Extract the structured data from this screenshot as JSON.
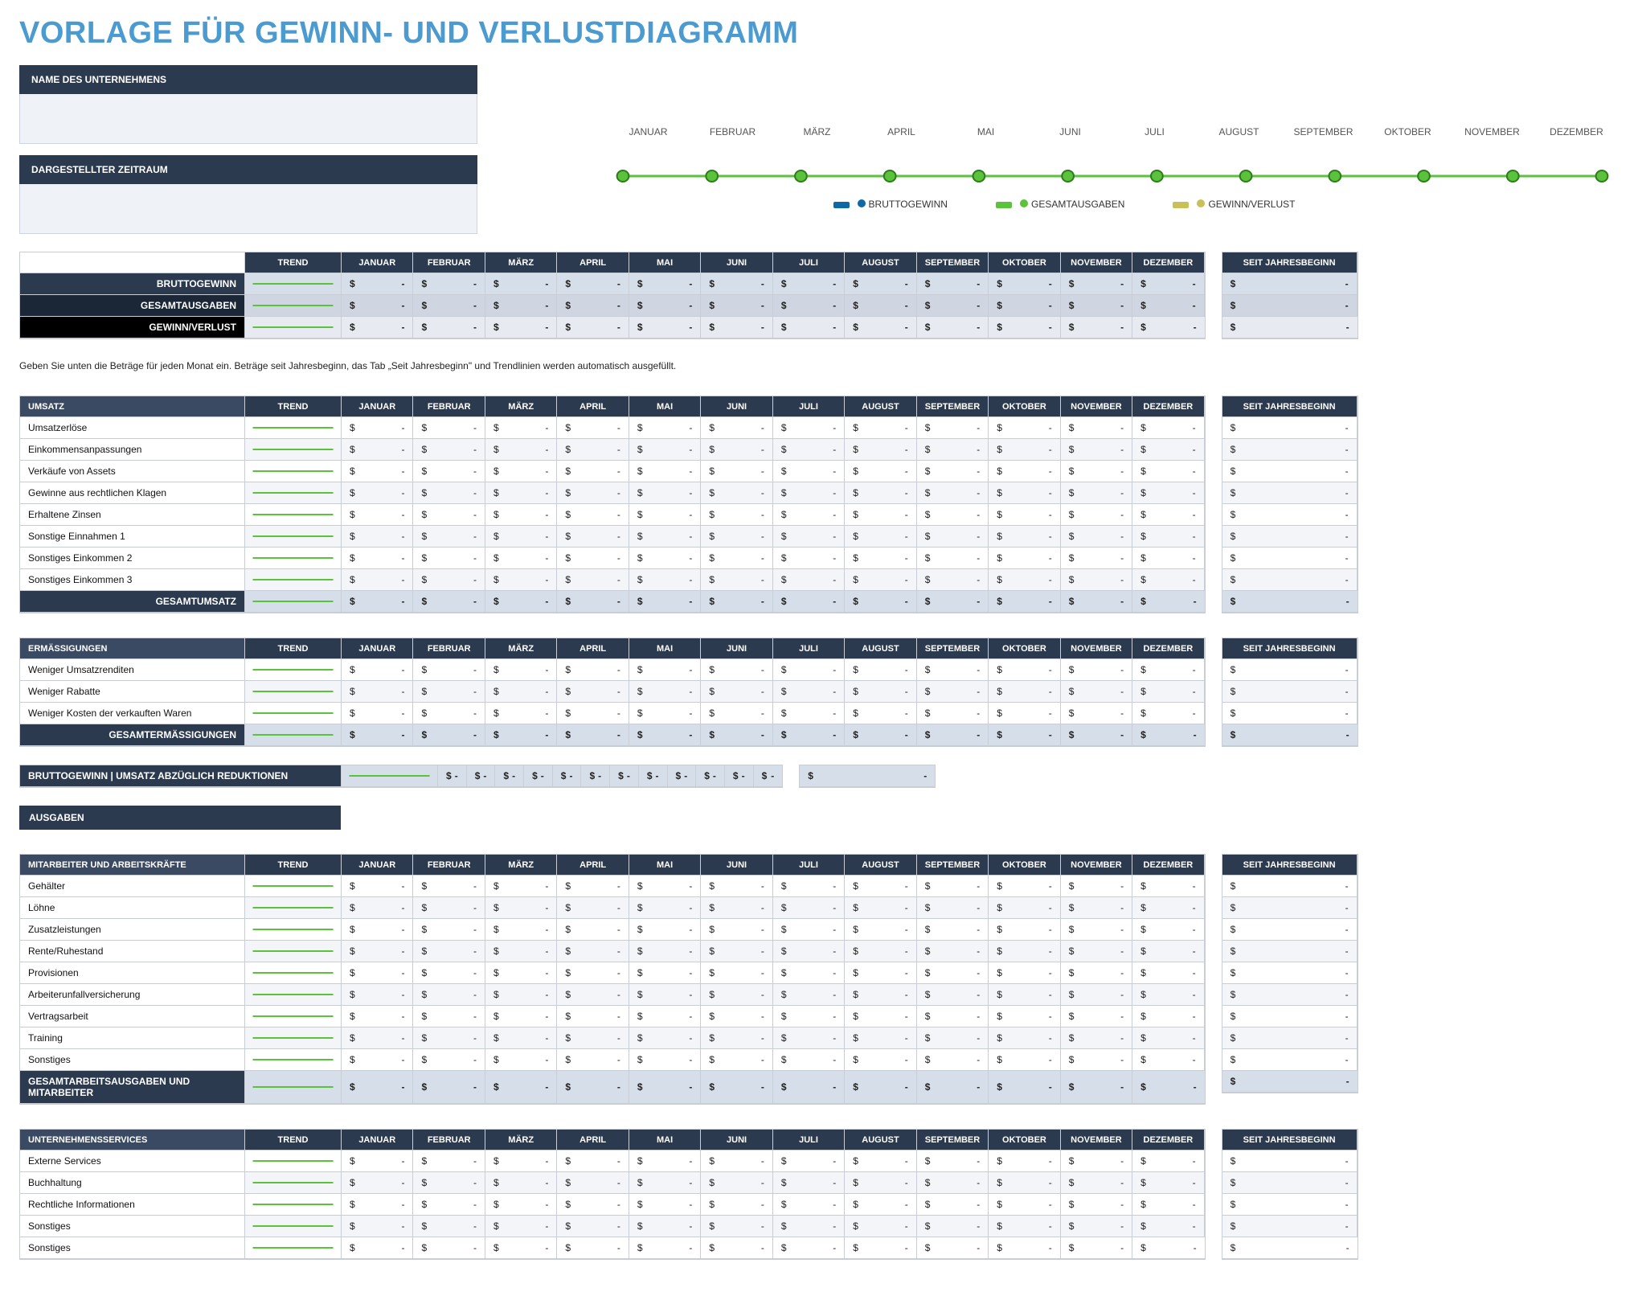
{
  "title": "VORLAGE FÜR GEWINN- UND VERLUSTDIAGRAMM",
  "company_label": "NAME DES UNTERNEHMENS",
  "period_label": "DARGESTELLTER ZEITRAUM",
  "months": [
    "JANUAR",
    "FEBRUAR",
    "MÄRZ",
    "APRIL",
    "MAI",
    "JUNI",
    "JULI",
    "AUGUST",
    "SEPTEMBER",
    "OKTOBER",
    "NOVEMBER",
    "DEZEMBER"
  ],
  "trend_label": "TREND",
  "ytd_label": "Seit Jahresbeginn",
  "legend": {
    "brutto": "BRUTTOGEWINN",
    "ausgaben": "GESAMTAUSGABEN",
    "gv": "GEWINN/VERLUST"
  },
  "currency": "$",
  "dash": "-",
  "summary_rows": [
    "BRUTTOGEWINN",
    "GESAMTAUSGABEN",
    "GEWINN/VERLUST"
  ],
  "note": "Geben Sie unten die Beträge für jeden Monat ein. Beträge seit Jahresbeginn, das Tab „Seit Jahresbeginn\" und Trendlinien werden automatisch ausgefüllt.",
  "sections": [
    {
      "key": "umsatz",
      "title": "UMSATZ",
      "rows": [
        "Umsatzerlöse",
        "Einkommensanpassungen",
        "Verkäufe von Assets",
        "Gewinne aus rechtlichen Klagen",
        "Erhaltene Zinsen",
        "Sonstige Einnahmen 1",
        "Sonstiges Einkommen 2",
        "Sonstiges Einkommen 3"
      ],
      "total": "GESAMTUMSATZ"
    },
    {
      "key": "ermass",
      "title": "ERMÄSSIGUNGEN",
      "rows": [
        "Weniger Umsatzrenditen",
        "Weniger Rabatte",
        "Weniger Kosten der verkauften Waren"
      ],
      "total": "GESAMTERMÄSSIGUNGEN"
    }
  ],
  "brutto_row_label": "BRUTTOGEWINN | UMSATZ ABZÜGLICH REDUKTIONEN",
  "ausgaben_title": "AUSGABEN",
  "subsections": [
    {
      "key": "labor",
      "title": "MITARBEITER UND ARBEITSKRÄFTE",
      "rows": [
        "Gehälter",
        "Löhne",
        "Zusatzleistungen",
        "Rente/Ruhestand",
        "Provisionen",
        "Arbeiterunfallversicherung",
        "Vertragsarbeit",
        "Training",
        "Sonstiges"
      ],
      "total": "GESAMTARBEITSAUSGABEN UND MITARBEITER"
    },
    {
      "key": "services",
      "title": "UNTERNEHMENSSERVICES",
      "rows": [
        "Externe Services",
        "Buchhaltung",
        "Rechtliche Informationen",
        "Sonstiges",
        "Sonstiges"
      ],
      "total": ""
    }
  ],
  "chart_data": {
    "type": "line",
    "categories": [
      "JANUAR",
      "FEBRUAR",
      "MÄRZ",
      "APRIL",
      "MAI",
      "JUNI",
      "JULI",
      "AUGUST",
      "SEPTEMBER",
      "OKTOBER",
      "NOVEMBER",
      "DEZEMBER"
    ],
    "series": [
      {
        "name": "BRUTTOGEWINN",
        "values": [
          0,
          0,
          0,
          0,
          0,
          0,
          0,
          0,
          0,
          0,
          0,
          0
        ],
        "color": "#0d69a6"
      },
      {
        "name": "GESAMTAUSGABEN",
        "values": [
          0,
          0,
          0,
          0,
          0,
          0,
          0,
          0,
          0,
          0,
          0,
          0
        ],
        "color": "#5bc23c"
      },
      {
        "name": "GEWINN/VERLUST",
        "values": [
          0,
          0,
          0,
          0,
          0,
          0,
          0,
          0,
          0,
          0,
          0,
          0
        ],
        "color": "#c9c05a"
      }
    ],
    "title": "",
    "xlabel": "",
    "ylabel": "",
    "ylim": [
      0,
      1
    ]
  }
}
